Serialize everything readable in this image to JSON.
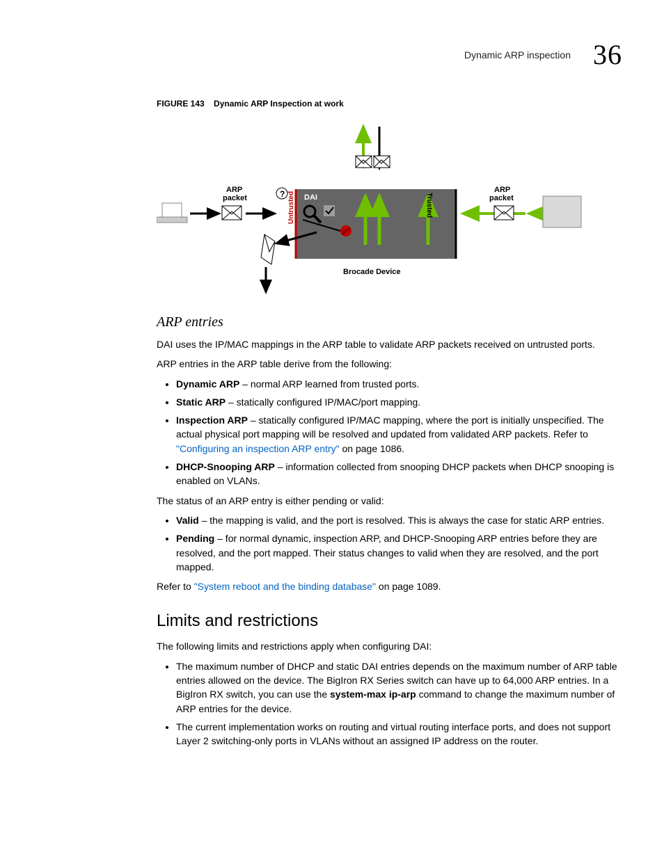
{
  "header": {
    "title": "Dynamic ARP inspection",
    "chapter": "36"
  },
  "figure": {
    "label": "FIGURE 143",
    "title": "Dynamic ARP Inspection at work",
    "labels": {
      "arp_left": "ARP\npacket",
      "arp_right": "ARP\npacket",
      "dai": "DAI",
      "untrusted": "Untrusted",
      "trusted": "Trusted",
      "device": "Brocade Device"
    }
  },
  "s1": {
    "heading": "ARP entries",
    "p1": "DAI uses the IP/MAC mappings in the ARP table to validate ARP packets received on untrusted ports.",
    "p2": "ARP entries in the ARP table derive from the following:",
    "items": [
      {
        "term": "Dynamic ARP",
        "text": " – normal ARP learned from trusted ports."
      },
      {
        "term": "Static ARP",
        "text": " – statically configured IP/MAC/port mapping."
      },
      {
        "term": "Inspection ARP",
        "text": " – statically configured IP/MAC mapping, where the port is initially unspecified. The actual physical port mapping will be resolved and updated from validated ARP packets. Refer to ",
        "xref": "\"Configuring an inspection ARP entry\"",
        "tail": " on page 1086."
      },
      {
        "term": "DHCP-Snooping ARP",
        "text": " – information collected from snooping DHCP packets when DHCP snooping is enabled on VLANs."
      }
    ],
    "p3": "The status of an ARP entry is either pending or valid:",
    "status": [
      {
        "term": "Valid",
        "text": " – the mapping is valid, and the port is resolved. This is always the case for static ARP entries."
      },
      {
        "term": "Pending",
        "text": " – for normal dynamic, inspection ARP, and DHCP-Snooping ARP entries before they are resolved, and the port mapped. Their status changes to valid when they are resolved, and the port mapped."
      }
    ],
    "p4_pre": "Refer to ",
    "p4_xref": "\"System reboot and the binding database\"",
    "p4_post": " on page 1089."
  },
  "s2": {
    "heading": "Limits and restrictions",
    "p1": "The following limits and restrictions apply when configuring DAI:",
    "items": [
      {
        "pre": "The maximum number of DHCP and static DAI entries depends on the maximum number of ARP table entries allowed on the device. The BigIron RX Series switch can have up to 64,000 ARP entries. In a BigIron RX switch, you can use the ",
        "cmd": "system-max ip-arp",
        "post": " command to change the maximum number of ARP entries for the device."
      },
      {
        "pre": "The current implementation works on routing and virtual routing interface ports, and does not support Layer 2 switching-only ports in VLANs without an assigned IP address on the router."
      }
    ]
  }
}
